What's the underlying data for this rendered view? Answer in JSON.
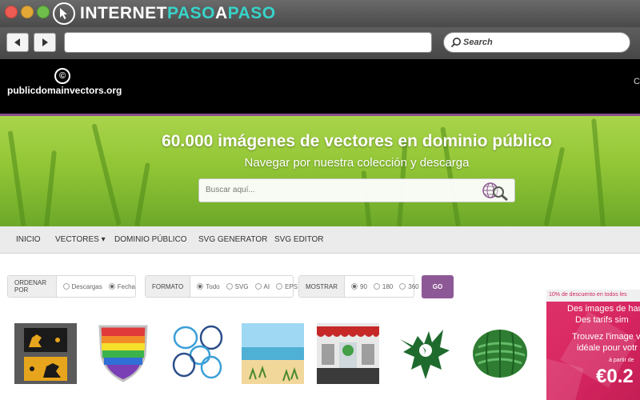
{
  "window": {
    "brand_left": "INTERNET",
    "brand_mid": "PASO",
    "brand_a": "A",
    "brand_right": "PASO",
    "colors": {
      "accent": "#37d3c9",
      "close": "#ee5b52",
      "minimize": "#e3a836",
      "maximize": "#6fbd4a"
    }
  },
  "toolbar": {
    "back_icon": "triangle-left-icon",
    "forward_icon": "triangle-right-icon",
    "url_value": "",
    "search_placeholder": "Search"
  },
  "site": {
    "logo_text": "publicdomainvectors.org",
    "logo_glyph": "©",
    "header_cut_text": "C",
    "brand_color": "#8a4d8f"
  },
  "hero": {
    "title": "60.000 imágenes de vectores en dominio público",
    "subtitle": "Navegar por nuestra colección y descarga",
    "search_placeholder": "Buscar aquí..."
  },
  "menu": {
    "items": [
      "INICIO",
      "VECTORES",
      "DOMINIO PÚBLICO",
      "SVG GENERATOR",
      "SVG EDITOR"
    ],
    "vectores_caret": "▾"
  },
  "filters": {
    "ordenar": {
      "label": "ORDENAR POR",
      "options": [
        "Descargas",
        "Fecha"
      ],
      "selected": "Fecha"
    },
    "formato": {
      "label": "FORMATO",
      "options": [
        "Todo",
        "SVG",
        "AI",
        "EPS"
      ],
      "selected": "Todo"
    },
    "mostrar": {
      "label": "MOSTRAR",
      "options": [
        "90",
        "180",
        "360"
      ],
      "selected": "90"
    },
    "go_label": "GO"
  },
  "thumbnails": [
    {
      "name": "business-cards-horse"
    },
    {
      "name": "rainbow-shield"
    },
    {
      "name": "blue-circle-frames"
    },
    {
      "name": "beach-scene"
    },
    {
      "name": "shop-front"
    },
    {
      "name": "green-eagle"
    },
    {
      "name": "watermelon"
    }
  ],
  "ad": {
    "top": "10% de descuento en todos les",
    "line1": "Des images de hau",
    "line2": "Des tarifs sim",
    "line3": "Trouvez l'image v",
    "line4": "idéale pour votr",
    "small": "à partir de",
    "price": "€0.2",
    "color": "#d62560"
  }
}
